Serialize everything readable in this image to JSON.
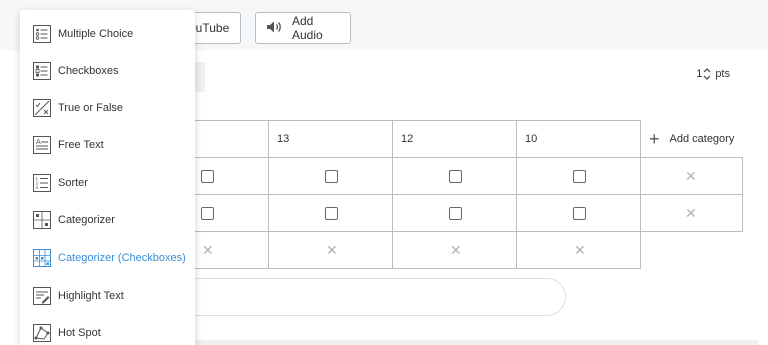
{
  "toolbar": {
    "youtube_label": "ouTube",
    "audio_label": "Add Audio"
  },
  "points": {
    "value": "1",
    "unit": "pts"
  },
  "categories": [
    {
      "label": "13"
    },
    {
      "label": "12"
    },
    {
      "label": "10"
    }
  ],
  "add_category_label": "Add category",
  "menu": {
    "items": [
      {
        "label": "Multiple Choice",
        "icon": "multiple-choice-icon"
      },
      {
        "label": "Checkboxes",
        "icon": "checkboxes-icon"
      },
      {
        "label": "True or False",
        "icon": "true-false-icon"
      },
      {
        "label": "Free Text",
        "icon": "free-text-icon"
      },
      {
        "label": "Sorter",
        "icon": "sorter-icon"
      },
      {
        "label": "Categorizer",
        "icon": "categorizer-icon"
      },
      {
        "label": "Categorizer (Checkboxes)",
        "icon": "categorizer-checkboxes-icon",
        "active": true
      },
      {
        "label": "Highlight Text",
        "icon": "highlight-text-icon"
      },
      {
        "label": "Hot Spot",
        "icon": "hot-spot-icon"
      }
    ]
  },
  "colors": {
    "accent": "#3a8fd6",
    "border": "#b9bec4",
    "muted": "#b0b4b9"
  }
}
